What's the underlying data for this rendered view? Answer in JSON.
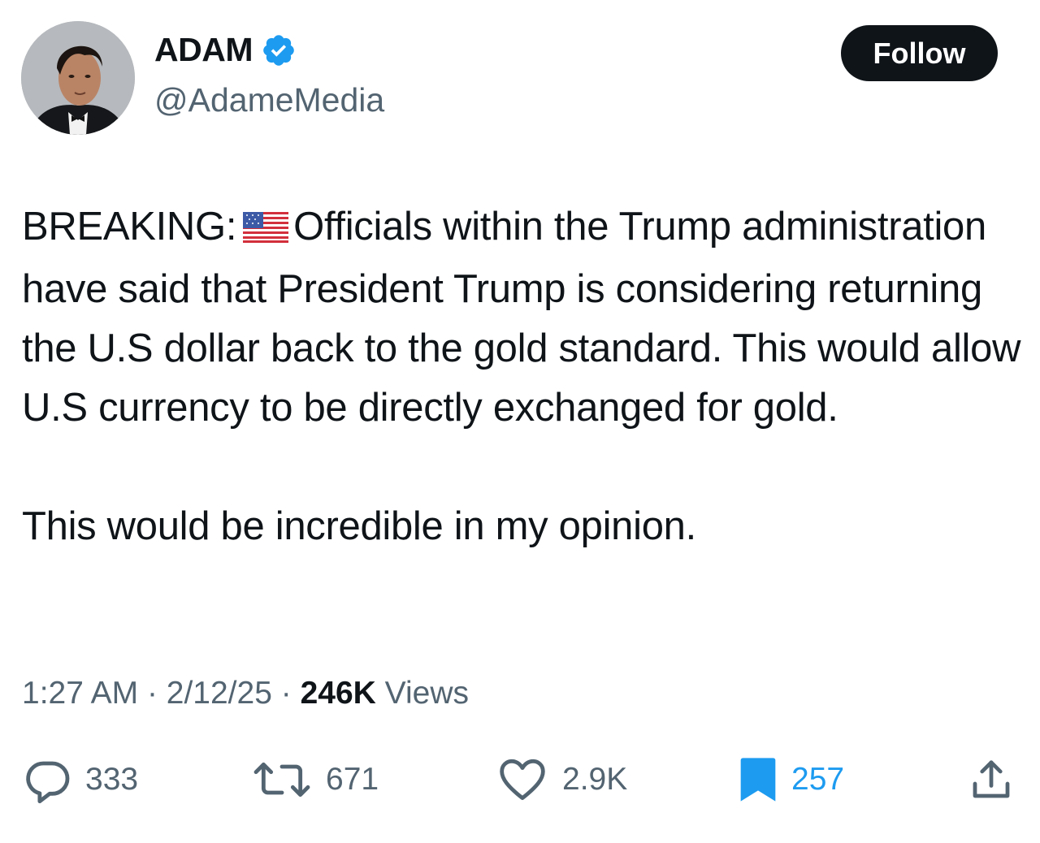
{
  "author": {
    "display_name": "ADAM",
    "handle": "@AdameMedia",
    "verified_icon": "verified-badge-icon",
    "avatar": "avatar"
  },
  "follow_label": "Follow",
  "tweet": {
    "prefix": "BREAKING:",
    "flag_icon": "us-flag-icon",
    "paragraph1": "Officials within the Trump administration have said that President Trump is considering returning the U.S dollar back to the gold standard. This would allow U.S currency to be directly exchanged for gold.",
    "paragraph2": "This would be incredible in my opinion."
  },
  "meta": {
    "time": "1:27 AM",
    "date": "2/12/25",
    "views_count": "246K",
    "views_label": "Views",
    "separator": "·"
  },
  "actions": {
    "replies": {
      "icon": "reply-icon",
      "count": "333"
    },
    "reposts": {
      "icon": "repost-icon",
      "count": "671"
    },
    "likes": {
      "icon": "heart-icon",
      "count": "2.9K"
    },
    "bookmarks": {
      "icon": "bookmark-icon",
      "count": "257",
      "active": true
    },
    "share": {
      "icon": "share-icon"
    }
  },
  "colors": {
    "text": "#0f1419",
    "secondary": "#536471",
    "accent": "#1d9bf0",
    "button_bg": "#0f1419"
  }
}
